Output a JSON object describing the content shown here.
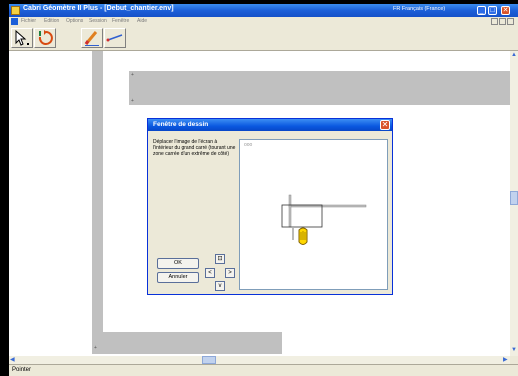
{
  "window": {
    "title": "Cabri Géomètre II Plus - [Debut_chantier.env]",
    "language_indicator": "FR Français (France)",
    "minimize_glyph": "_",
    "maximize_glyph": "□",
    "close_glyph": "✕"
  },
  "menubar": {
    "items": [
      "Fichier",
      "Edition",
      "Options",
      "Session",
      "Fenêtre",
      "Aide"
    ]
  },
  "workspace": {
    "corner_marker": "+"
  },
  "dialog": {
    "title": "Fenêtre de dessin",
    "close_glyph": "✕",
    "instructions": "Déplacer l'image de l'écran à l'intérieur du grand carré (tourant une zone carrée d'un extrême de côté)",
    "ok_label": "OK",
    "cancel_label": "Annuler",
    "arrows": {
      "center": "⊡",
      "left": "<",
      "right": ">",
      "down": "v"
    },
    "preview_label": "ooo"
  },
  "scrollbars": {
    "left_arrow": "◀",
    "right_arrow": "▶",
    "up_arrow": "▲",
    "down_arrow": "▼"
  },
  "statusbar": {
    "text": "Pointer"
  },
  "colors": {
    "titlebar": "#1c5fd8",
    "dialog_border": "#0831d9",
    "close_button": "#d9532a",
    "highlight_yellow": "#ffd700"
  }
}
